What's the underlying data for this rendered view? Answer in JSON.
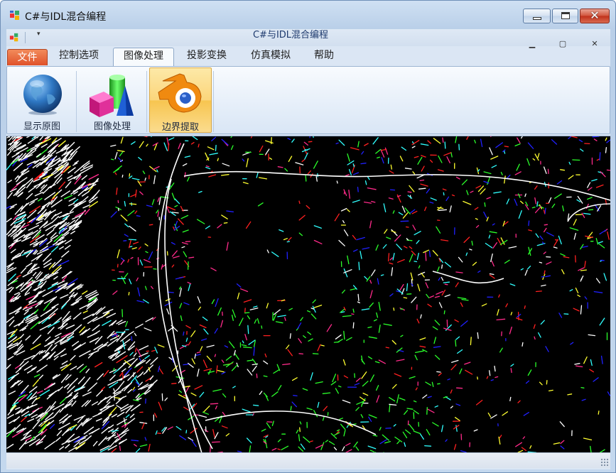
{
  "window": {
    "title": "C#与IDL混合编程",
    "icon": "app-icon"
  },
  "inner": {
    "title": "C#与IDL混合编程",
    "qat_arrow": "▾",
    "mdi_min": "▫",
    "mdi_max": "▫",
    "mdi_close": "✕"
  },
  "tabs": [
    {
      "label": "文件"
    },
    {
      "label": "控制选项"
    },
    {
      "label": "图像处理"
    },
    {
      "label": "投影变换"
    },
    {
      "label": "仿真模拟"
    },
    {
      "label": "帮助"
    }
  ],
  "ribbon": {
    "buttons": [
      {
        "label": "显示原图",
        "icon": "globe-icon"
      },
      {
        "label": "图像处理",
        "icon": "shapes-icon"
      },
      {
        "label": "边界提取",
        "icon": "blender-icon",
        "selected": true
      }
    ]
  },
  "canvas": {
    "description_color_bg": "#000000",
    "edge_colors": [
      "#ffffff",
      "#ff2a8a",
      "#2020ff",
      "#2aff2a",
      "#ff2020",
      "#ffff30",
      "#30ffff"
    ]
  },
  "caption": {
    "close_glyph": "✕"
  }
}
